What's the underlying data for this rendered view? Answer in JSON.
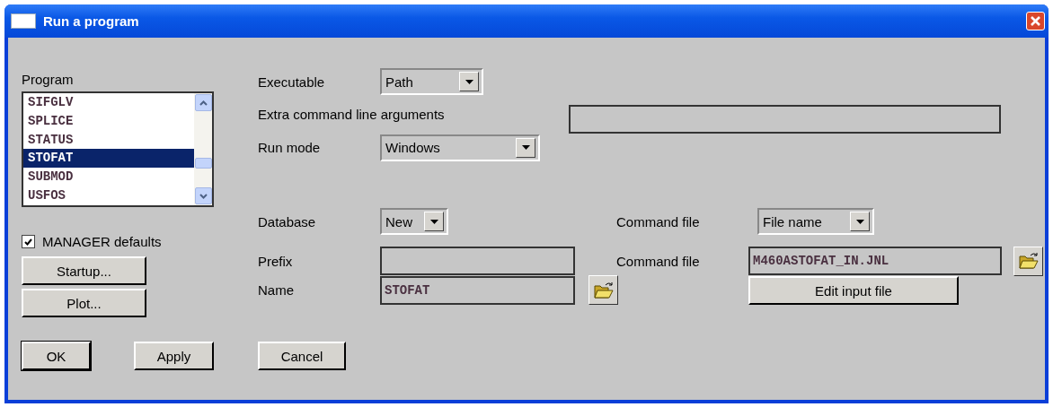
{
  "window": {
    "title": "Run a program"
  },
  "program": {
    "label": "Program",
    "items": [
      {
        "name": "SIFGLV",
        "selected": false
      },
      {
        "name": "SPLICE",
        "selected": false
      },
      {
        "name": "STATUS",
        "selected": false
      },
      {
        "name": "STOFAT",
        "selected": true
      },
      {
        "name": "SUBMOD",
        "selected": false
      },
      {
        "name": "USFOS",
        "selected": false
      }
    ]
  },
  "manager_defaults": {
    "label": "MANAGER defaults",
    "checked": true
  },
  "side_buttons": [
    "Startup...",
    "Plot..."
  ],
  "executable": {
    "label": "Executable",
    "value": "Path"
  },
  "extra_args": {
    "label": "Extra command line arguments"
  },
  "run_mode": {
    "label": "Run mode",
    "value": "Windows"
  },
  "database": {
    "label": "Database",
    "value": "New"
  },
  "prefix": {
    "label": "Prefix"
  },
  "name": {
    "label": "Name",
    "value": "STOFAT"
  },
  "command_file_type": {
    "label": "Command file",
    "value": "File name"
  },
  "command_file": {
    "label": "Command file",
    "value": "M460ASTOFAT_IN.JNL"
  },
  "edit_button": "Edit input file",
  "buttons": [
    {
      "label": "OK",
      "default": true
    },
    {
      "label": "Apply",
      "default": false
    },
    {
      "label": "Cancel",
      "default": false
    }
  ]
}
